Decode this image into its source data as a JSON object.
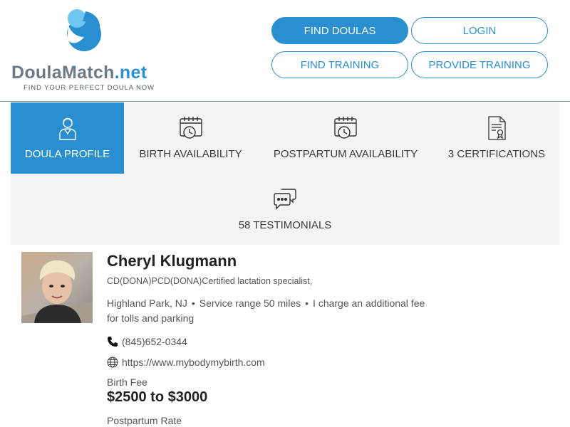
{
  "brand": {
    "name_main": "DoulaMatch",
    "name_suffix": ".net",
    "tagline": "FIND YOUR PERFECT DOULA NOW",
    "colors": {
      "primary": "#2a8fd0",
      "light": "#6ec6f1",
      "gray": "#6d7a85"
    }
  },
  "nav": {
    "find_doulas": "FIND DOULAS",
    "login": "LOGIN",
    "find_training": "FIND TRAINING",
    "provide_training": "PROVIDE TRAINING"
  },
  "tabs": [
    {
      "label": "DOULA PROFILE",
      "icon": "doula-person-icon",
      "active": true
    },
    {
      "label": "BIRTH AVAILABILITY",
      "icon": "calendar-clock-icon"
    },
    {
      "label": "POSTPARTUM AVAILABILITY",
      "icon": "calendar-clock-icon"
    },
    {
      "label": "3 CERTIFICATIONS",
      "icon": "certificate-icon"
    },
    {
      "label": "58 TESTIMONIALS",
      "icon": "chat-bubbles-icon"
    }
  ],
  "profile": {
    "name": "Cheryl Klugmann",
    "credentials": "CD(DONA)PCD(DONA)Certified lactation specialist,",
    "location": "Highland Park, NJ",
    "service_range": "Service range 50 miles",
    "extra_fee_line1": "I charge an additional fee",
    "extra_fee_line2": "for tolls and parking",
    "phone": "(845)652-0344",
    "website": "https://www.mybodymybirth.com",
    "birth_fee_label": "Birth Fee",
    "birth_fee": "$2500 to $3000",
    "postpartum_label": "Postpartum Rate"
  }
}
